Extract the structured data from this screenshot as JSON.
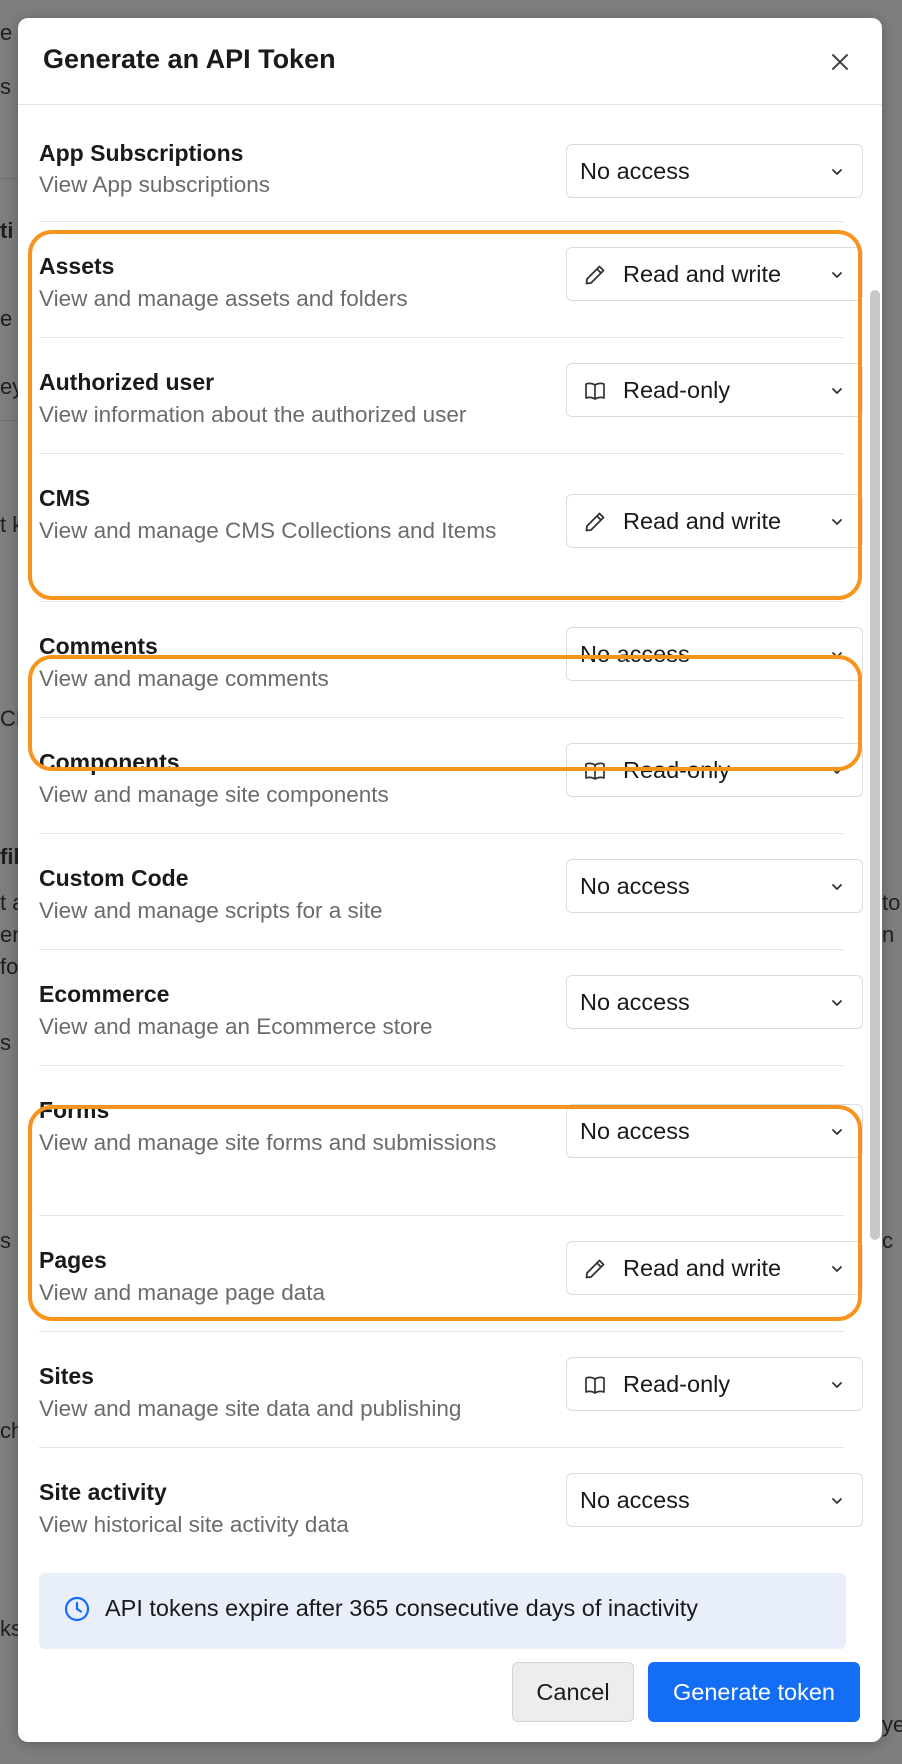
{
  "modal": {
    "title": "Generate an API Token"
  },
  "permissions": [
    {
      "name": "App Subscriptions",
      "desc": "View App subscriptions",
      "access": "No access",
      "icon": "none"
    },
    {
      "name": "Assets",
      "desc": "View and manage assets and folders",
      "access": "Read and write",
      "icon": "pencil-icon"
    },
    {
      "name": "Authorized user",
      "desc": "View information about the authorized user",
      "access": "Read-only",
      "icon": "book-icon"
    },
    {
      "name": "CMS",
      "desc": "View and manage CMS Collections and Items",
      "access": "Read and write",
      "icon": "pencil-icon"
    },
    {
      "name": "Comments",
      "desc": "View and manage comments",
      "access": "No access",
      "icon": "none"
    },
    {
      "name": "Components",
      "desc": "View and manage site components",
      "access": "Read-only",
      "icon": "book-icon"
    },
    {
      "name": "Custom Code",
      "desc": "View and manage scripts for a site",
      "access": "No access",
      "icon": "none"
    },
    {
      "name": "Ecommerce",
      "desc": "View and manage an Ecommerce store",
      "access": "No access",
      "icon": "none"
    },
    {
      "name": "Forms",
      "desc": "View and manage site forms and submissions",
      "access": "No access",
      "icon": "none"
    },
    {
      "name": "Pages",
      "desc": "View and manage page data",
      "access": "Read and write",
      "icon": "pencil-icon"
    },
    {
      "name": "Sites",
      "desc": "View and manage site data and publishing",
      "access": "Read-only",
      "icon": "book-icon"
    },
    {
      "name": "Site activity",
      "desc": "View historical site activity data",
      "access": "No access",
      "icon": "none"
    }
  ],
  "info": {
    "text": "API tokens expire after 365 consecutive days of inactivity"
  },
  "footer": {
    "cancel_label": "Cancel",
    "generate_label": "Generate token"
  },
  "colors": {
    "highlight": "#f7941d",
    "primary": "#146ef5",
    "info_bg": "#e9eefb"
  }
}
